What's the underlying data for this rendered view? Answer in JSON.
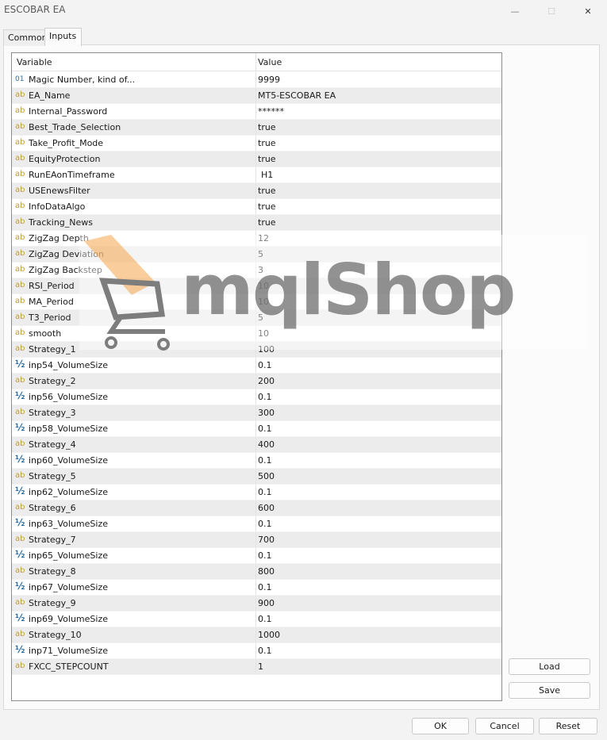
{
  "window": {
    "title": "ESCOBAR EA",
    "minimize_glyph": "—",
    "maximize_glyph": "☐",
    "close_glyph": "✕"
  },
  "tabs": [
    {
      "label": "Common"
    },
    {
      "label": "Inputs"
    }
  ],
  "table": {
    "columns": [
      "Variable",
      "Value"
    ],
    "rows": [
      {
        "icon": "int-icon",
        "glyph": "01",
        "name": "Magic Number, kind of...",
        "value": "9999"
      },
      {
        "icon": "string-icon",
        "glyph": "ab",
        "name": "EA_Name",
        "value": "MT5-ESCOBAR EA"
      },
      {
        "icon": "string-icon",
        "glyph": "ab",
        "name": "Internal_Password",
        "value": "******"
      },
      {
        "icon": "string-icon",
        "glyph": "ab",
        "name": "Best_Trade_Selection",
        "value": "true"
      },
      {
        "icon": "string-icon",
        "glyph": "ab",
        "name": "Take_Profit_Mode",
        "value": "true"
      },
      {
        "icon": "string-icon",
        "glyph": "ab",
        "name": "EquityProtection",
        "value": "true"
      },
      {
        "icon": "string-icon",
        "glyph": "ab",
        "name": "RunEAonTimeframe",
        "value": "H1"
      },
      {
        "icon": "string-icon",
        "glyph": "ab",
        "name": "USEnewsFilter",
        "value": "true"
      },
      {
        "icon": "string-icon",
        "glyph": "ab",
        "name": "InfoDataAlgo",
        "value": "true"
      },
      {
        "icon": "string-icon",
        "glyph": "ab",
        "name": "Tracking_News",
        "value": "true"
      },
      {
        "icon": "string-icon",
        "glyph": "ab",
        "name": "ZigZag Depth",
        "value": "12"
      },
      {
        "icon": "string-icon",
        "glyph": "ab",
        "name": "ZigZag Deviation",
        "value": "5"
      },
      {
        "icon": "string-icon",
        "glyph": "ab",
        "name": "ZigZag Backstep",
        "value": "3"
      },
      {
        "icon": "string-icon",
        "glyph": "ab",
        "name": "RSI_Period",
        "value": "10"
      },
      {
        "icon": "string-icon",
        "glyph": "ab",
        "name": "MA_Period",
        "value": "10"
      },
      {
        "icon": "string-icon",
        "glyph": "ab",
        "name": "T3_Period",
        "value": "5"
      },
      {
        "icon": "string-icon",
        "glyph": "ab",
        "name": "smooth",
        "value": "10"
      },
      {
        "icon": "string-icon",
        "glyph": "ab",
        "name": "Strategy_1",
        "value": "100"
      },
      {
        "icon": "double-icon",
        "glyph": "½",
        "name": "inp54_VolumeSize",
        "value": "0.1"
      },
      {
        "icon": "string-icon",
        "glyph": "ab",
        "name": "Strategy_2",
        "value": "200"
      },
      {
        "icon": "double-icon",
        "glyph": "½",
        "name": "inp56_VolumeSize",
        "value": "0.1"
      },
      {
        "icon": "string-icon",
        "glyph": "ab",
        "name": "Strategy_3",
        "value": "300"
      },
      {
        "icon": "double-icon",
        "glyph": "½",
        "name": "inp58_VolumeSize",
        "value": "0.1"
      },
      {
        "icon": "string-icon",
        "glyph": "ab",
        "name": "Strategy_4",
        "value": "400"
      },
      {
        "icon": "double-icon",
        "glyph": "½",
        "name": "inp60_VolumeSize",
        "value": "0.1"
      },
      {
        "icon": "string-icon",
        "glyph": "ab",
        "name": "Strategy_5",
        "value": "500"
      },
      {
        "icon": "double-icon",
        "glyph": "½",
        "name": "inp62_VolumeSize",
        "value": "0.1"
      },
      {
        "icon": "string-icon",
        "glyph": "ab",
        "name": "Strategy_6",
        "value": "600"
      },
      {
        "icon": "double-icon",
        "glyph": "½",
        "name": "inp63_VolumeSize",
        "value": "0.1"
      },
      {
        "icon": "string-icon",
        "glyph": "ab",
        "name": "Strategy_7",
        "value": "700"
      },
      {
        "icon": "double-icon",
        "glyph": "½",
        "name": "inp65_VolumeSize",
        "value": "0.1"
      },
      {
        "icon": "string-icon",
        "glyph": "ab",
        "name": "Strategy_8",
        "value": "800"
      },
      {
        "icon": "double-icon",
        "glyph": "½",
        "name": "inp67_VolumeSize",
        "value": "0.1"
      },
      {
        "icon": "string-icon",
        "glyph": "ab",
        "name": "Strategy_9",
        "value": "900"
      },
      {
        "icon": "double-icon",
        "glyph": "½",
        "name": "inp69_VolumeSize",
        "value": "0.1"
      },
      {
        "icon": "string-icon",
        "glyph": "ab",
        "name": "Strategy_10",
        "value": "1000"
      },
      {
        "icon": "double-icon",
        "glyph": "½",
        "name": "inp71_VolumeSize",
        "value": "0.1"
      },
      {
        "icon": "string-icon",
        "glyph": "ab",
        "name": "FXCC_STEPCOUNT",
        "value": "1"
      }
    ]
  },
  "side_buttons": {
    "load": "Load",
    "save": "Save"
  },
  "footer_buttons": {
    "ok": "OK",
    "cancel": "Cancel",
    "reset": "Reset"
  },
  "watermark": {
    "text": "mqlShop",
    "colors": {
      "cart_fill": "#f6a64a",
      "cart_stroke": "#7d7d7d",
      "text": "#6e6e6e"
    }
  }
}
